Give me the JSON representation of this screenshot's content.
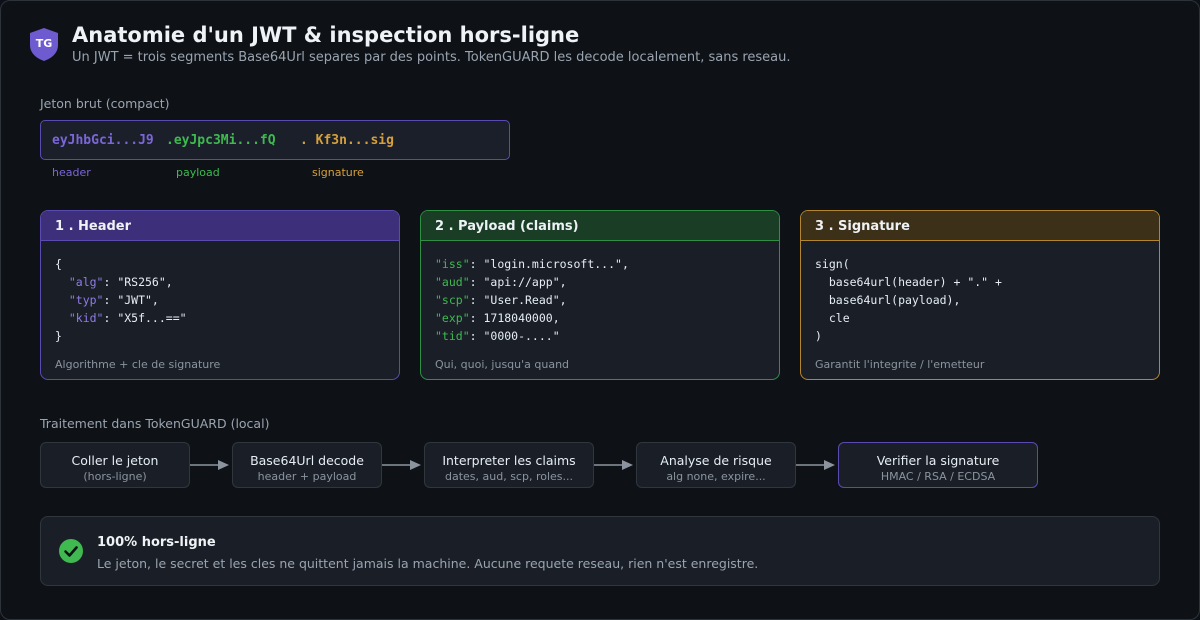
{
  "header": {
    "logo_text": "TG",
    "title": "Anatomie d'un JWT & inspection hors-ligne",
    "subtitle": "Un JWT = trois segments Base64Url separes par des points. TokenGUARD les decode localement, sans reseau."
  },
  "token": {
    "section_label": "Jeton brut (compact)",
    "header_segment": "eyJhbGci...J9",
    "payload_segment": ".eyJpc3Mi...fQ",
    "signature_segment": ". Kf3n...sig",
    "header_label": "header",
    "payload_label": "payload",
    "signature_label": "signature"
  },
  "cards": {
    "header": {
      "title": "1 . Header",
      "footer": "Algorithme + cle de signature",
      "lines": [
        {
          "key": "",
          "rest": "{"
        },
        {
          "key": "  \"alg\"",
          "rest": ": \"RS256\","
        },
        {
          "key": "  \"typ\"",
          "rest": ": \"JWT\","
        },
        {
          "key": "  \"kid\"",
          "rest": ": \"X5f...==\""
        },
        {
          "key": "",
          "rest": "}"
        }
      ]
    },
    "payload": {
      "title": "2 . Payload (claims)",
      "footer": "Qui, quoi, jusqu'a quand",
      "lines": [
        {
          "key": "\"iss\"",
          "rest": ": \"login.microsoft...\","
        },
        {
          "key": "\"aud\"",
          "rest": ": \"api://app\","
        },
        {
          "key": "\"scp\"",
          "rest": ": \"User.Read\","
        },
        {
          "key": "\"exp\"",
          "rest": ": 1718040000,"
        },
        {
          "key": "\"tid\"",
          "rest": ": \"0000-....\""
        }
      ]
    },
    "signature": {
      "title": "3 . Signature",
      "footer": "Garantit l'integrite / l'emetteur",
      "lines": [
        {
          "key": "",
          "rest": "sign("
        },
        {
          "key": "",
          "rest": "  base64url(header) + \".\" +"
        },
        {
          "key": "",
          "rest": "  base64url(payload),"
        },
        {
          "key": "",
          "rest": "  cle"
        },
        {
          "key": "",
          "rest": ")"
        }
      ]
    }
  },
  "pipeline": {
    "section_label": "Traitement dans TokenGUARD (local)",
    "steps": [
      {
        "title": "Coller le jeton",
        "sub": "(hors-ligne)"
      },
      {
        "title": "Base64Url decode",
        "sub": "header + payload"
      },
      {
        "title": "Interpreter les claims",
        "sub": "dates, aud, scp, roles..."
      },
      {
        "title": "Analyse de risque",
        "sub": "alg none, expire..."
      },
      {
        "title": "Verifier la signature",
        "sub": "HMAC / RSA / ECDSA"
      }
    ]
  },
  "info": {
    "icon": "check-circle-icon",
    "title": "100% hors-ligne",
    "text": "Le jeton, le secret et les cles ne quittent jamais la machine. Aucune requete reseau, rien n'est enregistre."
  },
  "colors": {
    "header_accent": "#6e5bd0",
    "payload_accent": "#3fb950",
    "signature_accent": "#d6a03a",
    "success": "#3fb950"
  }
}
